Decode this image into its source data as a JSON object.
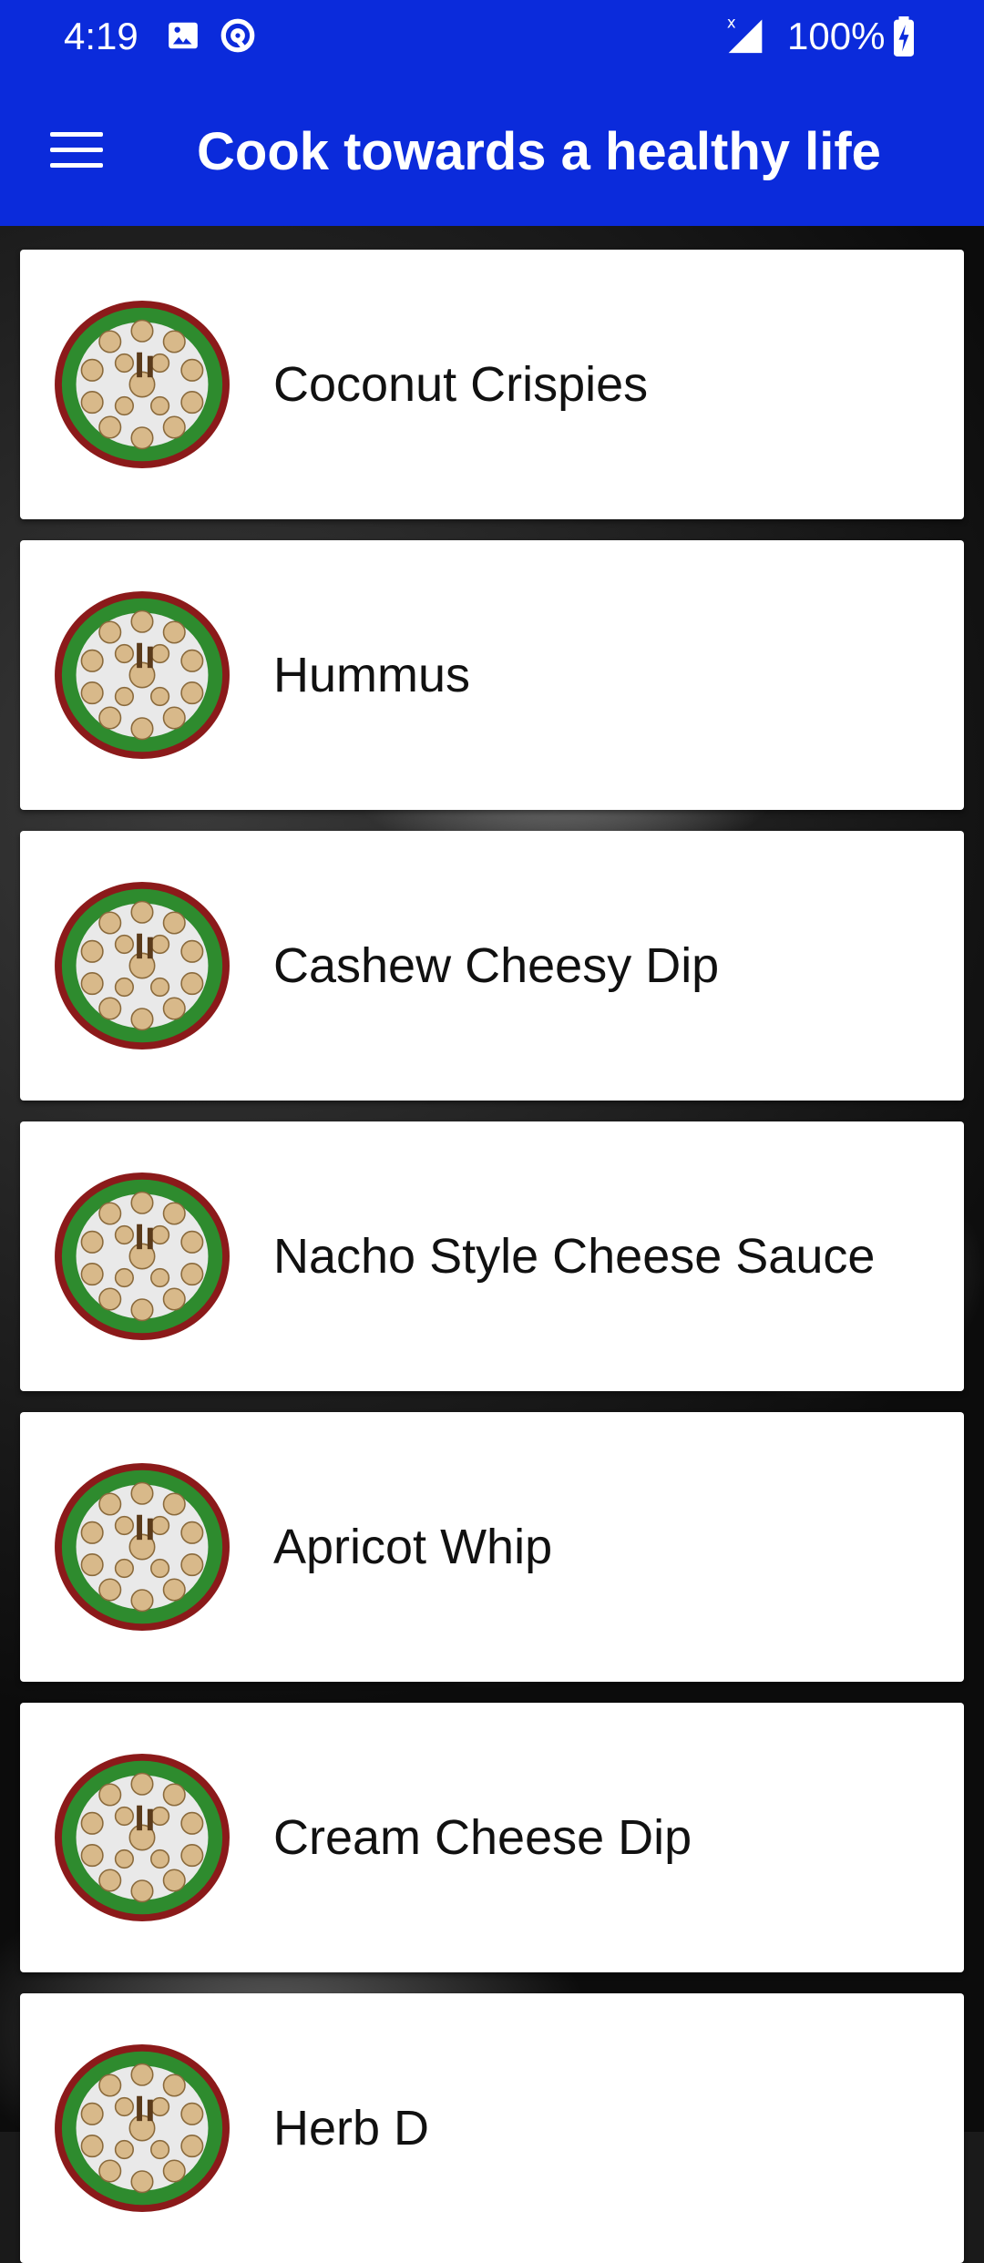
{
  "status_bar": {
    "time": "4:19",
    "battery": "100%",
    "icons": [
      "image-icon",
      "sync-icon",
      "signal-icon",
      "battery-charging-icon"
    ]
  },
  "app_bar": {
    "title": "Cook towards a healthy life",
    "menu_icon": "hamburger-menu-icon"
  },
  "colors": {
    "primary": "#0b2bdb",
    "card": "#ffffff",
    "thumb_ring": "#8b1a1a",
    "thumb_green": "#2e8b2e"
  },
  "recipes": [
    {
      "label": "Coconut Crispies"
    },
    {
      "label": "Hummus"
    },
    {
      "label": "Cashew Cheesy Dip"
    },
    {
      "label": "Nacho Style Cheese Sauce"
    },
    {
      "label": "Apricot Whip"
    },
    {
      "label": "Cream Cheese Dip"
    },
    {
      "label": "Herb D"
    }
  ]
}
